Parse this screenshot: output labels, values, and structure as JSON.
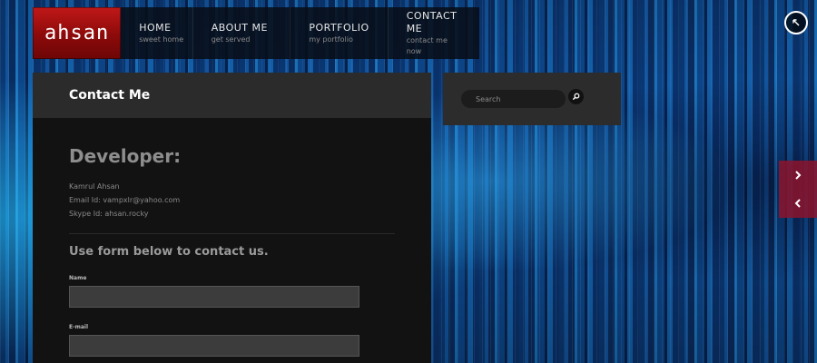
{
  "logo": {
    "text": "ahsan"
  },
  "nav": {
    "items": [
      {
        "title": "HOME",
        "subtitle": "sweet home"
      },
      {
        "title": "ABOUT ME",
        "subtitle": "get served"
      },
      {
        "title": "PORTFOLIO",
        "subtitle": "my portfolio"
      },
      {
        "title": "CONTACT ME",
        "subtitle": "contact me now"
      }
    ]
  },
  "page": {
    "title": "Contact Me",
    "developer_heading": "Developer:",
    "info": [
      "Kamrul Ahsan",
      "Email Id: vampxlr@yahoo.com",
      "Skype Id: ahsan.rocky"
    ],
    "form_heading": "Use form below to contact us.",
    "form": {
      "name_label": "Name",
      "name_value": "",
      "email_label": "E-mail",
      "email_value": ""
    }
  },
  "search": {
    "placeholder": "Search"
  },
  "icons": {
    "fullscreen": "fullscreen-toggle-icon",
    "search": "magnifier-icon",
    "next": "chevron-right-icon",
    "prev": "chevron-left-icon"
  },
  "colors": {
    "logo_red": "#a50f0f",
    "arrow_panel": "#8c142d",
    "panel_bg": "#121212",
    "panel_head": "#2b2b2b"
  }
}
